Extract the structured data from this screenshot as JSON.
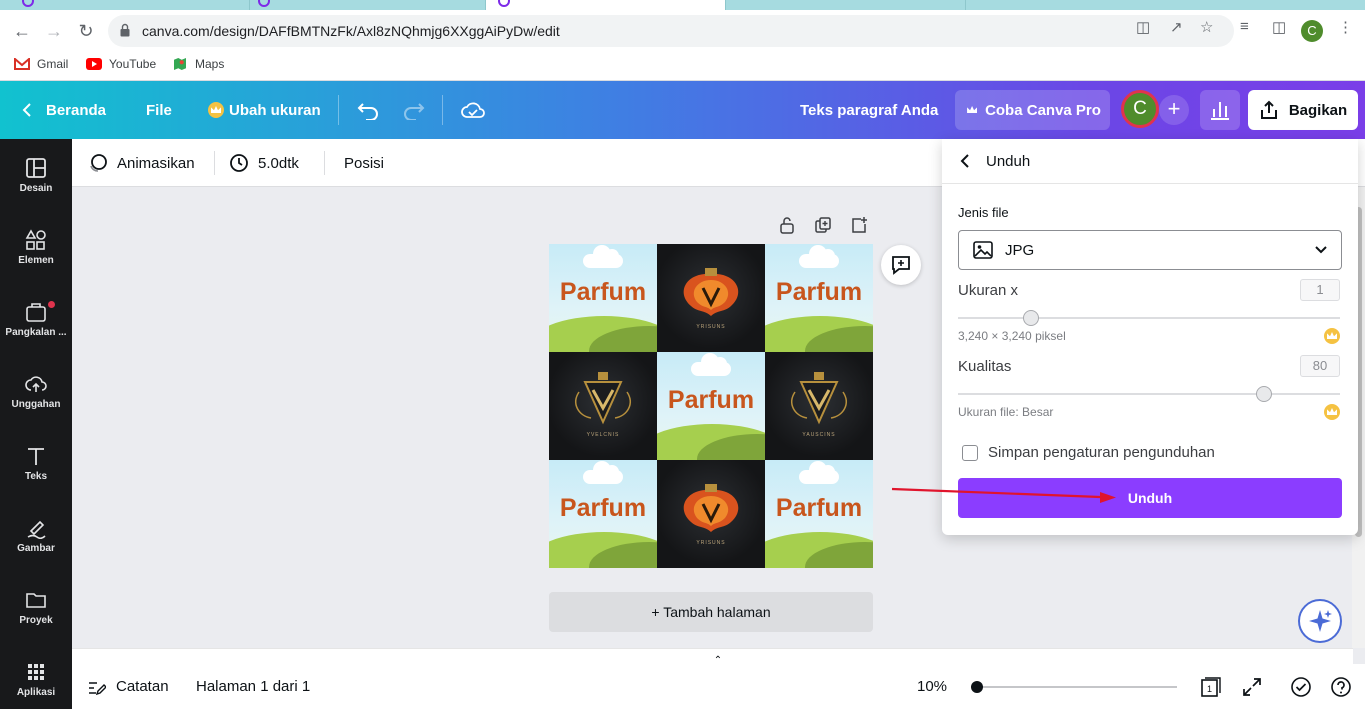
{
  "browser": {
    "url": "canva.com/design/DAFfBMTNzFk/Axl8zNQhmjg6XXggAiPyDw/edit",
    "profile_initial": "C",
    "bookmarks": [
      {
        "label": "Gmail",
        "icon": "gmail-icon"
      },
      {
        "label": "YouTube",
        "icon": "youtube-icon"
      },
      {
        "label": "Maps",
        "icon": "maps-icon"
      }
    ]
  },
  "header": {
    "home_label": "Beranda",
    "file_label": "File",
    "resize_label": "Ubah ukuran",
    "doc_title": "Teks paragraf Anda",
    "pro_label": "Coba Canva Pro",
    "avatar_initial": "C",
    "share_label": "Bagikan"
  },
  "sidebar": {
    "items": [
      {
        "label": "Desain",
        "icon": "layout-icon"
      },
      {
        "label": "Elemen",
        "icon": "shapes-icon"
      },
      {
        "label": "Pangkalan ...",
        "icon": "brand-kit-icon"
      },
      {
        "label": "Unggahan",
        "icon": "upload-cloud-icon"
      },
      {
        "label": "Teks",
        "icon": "text-icon"
      },
      {
        "label": "Gambar",
        "icon": "draw-icon"
      },
      {
        "label": "Proyek",
        "icon": "folder-icon"
      },
      {
        "label": "Aplikasi",
        "icon": "apps-grid-icon"
      }
    ]
  },
  "context_toolbar": {
    "animate_label": "Animasikan",
    "duration_label": "5.0dtk",
    "position_label": "Posisi"
  },
  "canvas": {
    "tile_text": "Parfum",
    "brand_text_1": "YRISUNS",
    "brand_text_2": "YVELCNIS",
    "brand_text_3": "YAUSCINS",
    "add_page_label": "+ Tambah halaman"
  },
  "footer": {
    "notes_label": "Catatan",
    "page_label": "Halaman 1 dari 1",
    "zoom_label": "10%",
    "page_count": "1"
  },
  "download_panel": {
    "title": "Unduh",
    "file_type_label": "Jenis file",
    "file_type_value": "JPG",
    "size_label": "Ukuran x",
    "size_value": "1",
    "size_fraction": 0.19,
    "size_hint": "3,240 × 3,240 piksel",
    "quality_label": "Kualitas",
    "quality_value": "80",
    "quality_fraction": 0.8,
    "quality_hint": "Ukuran file: Besar",
    "save_settings_label": "Simpan pengaturan pengunduhan",
    "save_settings_checked": false,
    "download_button": "Unduh"
  },
  "colors": {
    "accent_purple": "#8b3dff",
    "header_gradient_start": "#11c2cf",
    "header_gradient_end": "#7a3ee8",
    "annotation_arrow": "#e0142c"
  }
}
